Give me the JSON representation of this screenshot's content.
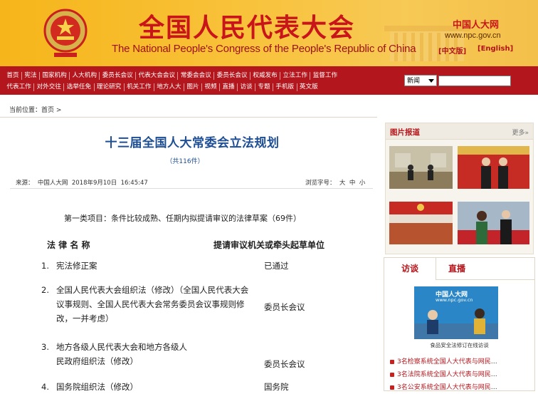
{
  "header": {
    "title_cn": "全国人民代表大会",
    "title_en": "The National People's Congress of the People's Republic of China",
    "site_name": "中国人大网",
    "site_url": "www.npc.gov.cn",
    "lang_cn": "[中文版]",
    "lang_en": "[English]"
  },
  "nav": {
    "row1": [
      "首页",
      "宪法",
      "国家机构",
      "人大机构",
      "委员长会议",
      "代表大会会议",
      "常委会会议",
      "委员长会议",
      "权威发布",
      "立法工作",
      "监督工作"
    ],
    "row2": [
      "代表工作",
      "对外交往",
      "选举任免",
      "理论研究",
      "机关工作",
      "地方人大",
      "图片",
      "视频",
      "直播",
      "访谈",
      "专题",
      "手机版",
      "英文版"
    ],
    "search_select": "新闻"
  },
  "breadcrumb": {
    "label": "当前位置：",
    "home": "首页",
    "sep": ">"
  },
  "article": {
    "title": "十三届全国人大常委会立法规划",
    "count": "（共116件）",
    "source_label": "来源：",
    "source": "中国人大网",
    "date": "2018年9月10日",
    "time": "16:45:47",
    "font_label": "浏览字号：",
    "font_sizes": [
      "大",
      "中",
      "小"
    ],
    "category": "第一类项目：条件比较成熟、任期内拟提请审议的法律草案（69件）",
    "col_law": "法 律 名 称",
    "col_unit": "提请审议机关或牵头起草单位",
    "laws": [
      {
        "num": "1.",
        "name": "宪法修正案",
        "unit": "已通过"
      },
      {
        "num": "2.",
        "name": "全国人民代表大会组织法（修改）（全国人民代表大会议事规则、全国人民代表大会常务委员会议事规则修改，一并考虑）",
        "unit": "委员长会议"
      },
      {
        "num": "3.",
        "name": "地方各级人民代表大会和地方各级人民政府组织法（修改）",
        "unit": "委员长会议"
      },
      {
        "num": "4.",
        "name": "国务院组织法（修改）",
        "unit": "国务院"
      }
    ]
  },
  "sidebar": {
    "pictures_title": "图片报道",
    "more": "更多»",
    "tab_interview": "访谈",
    "tab_live": "直播",
    "video_logo": "中国人大网",
    "video_url": "www.npc.gov.cn",
    "video_caption": "食品安全法修订在线访谈",
    "news": [
      {
        "hl": "3名检察系统全国人大代表与网民",
        "rest": "…"
      },
      {
        "hl": "3名法院系统全国人大代表与网民",
        "rest": "…"
      },
      {
        "hl": "3名公安系统全国人大代表与网民",
        "rest": "…"
      }
    ]
  },
  "colors": {
    "brand_red": "#b3161c",
    "title_blue": "#1e4e94",
    "banner_gold": "#f6b51a"
  }
}
